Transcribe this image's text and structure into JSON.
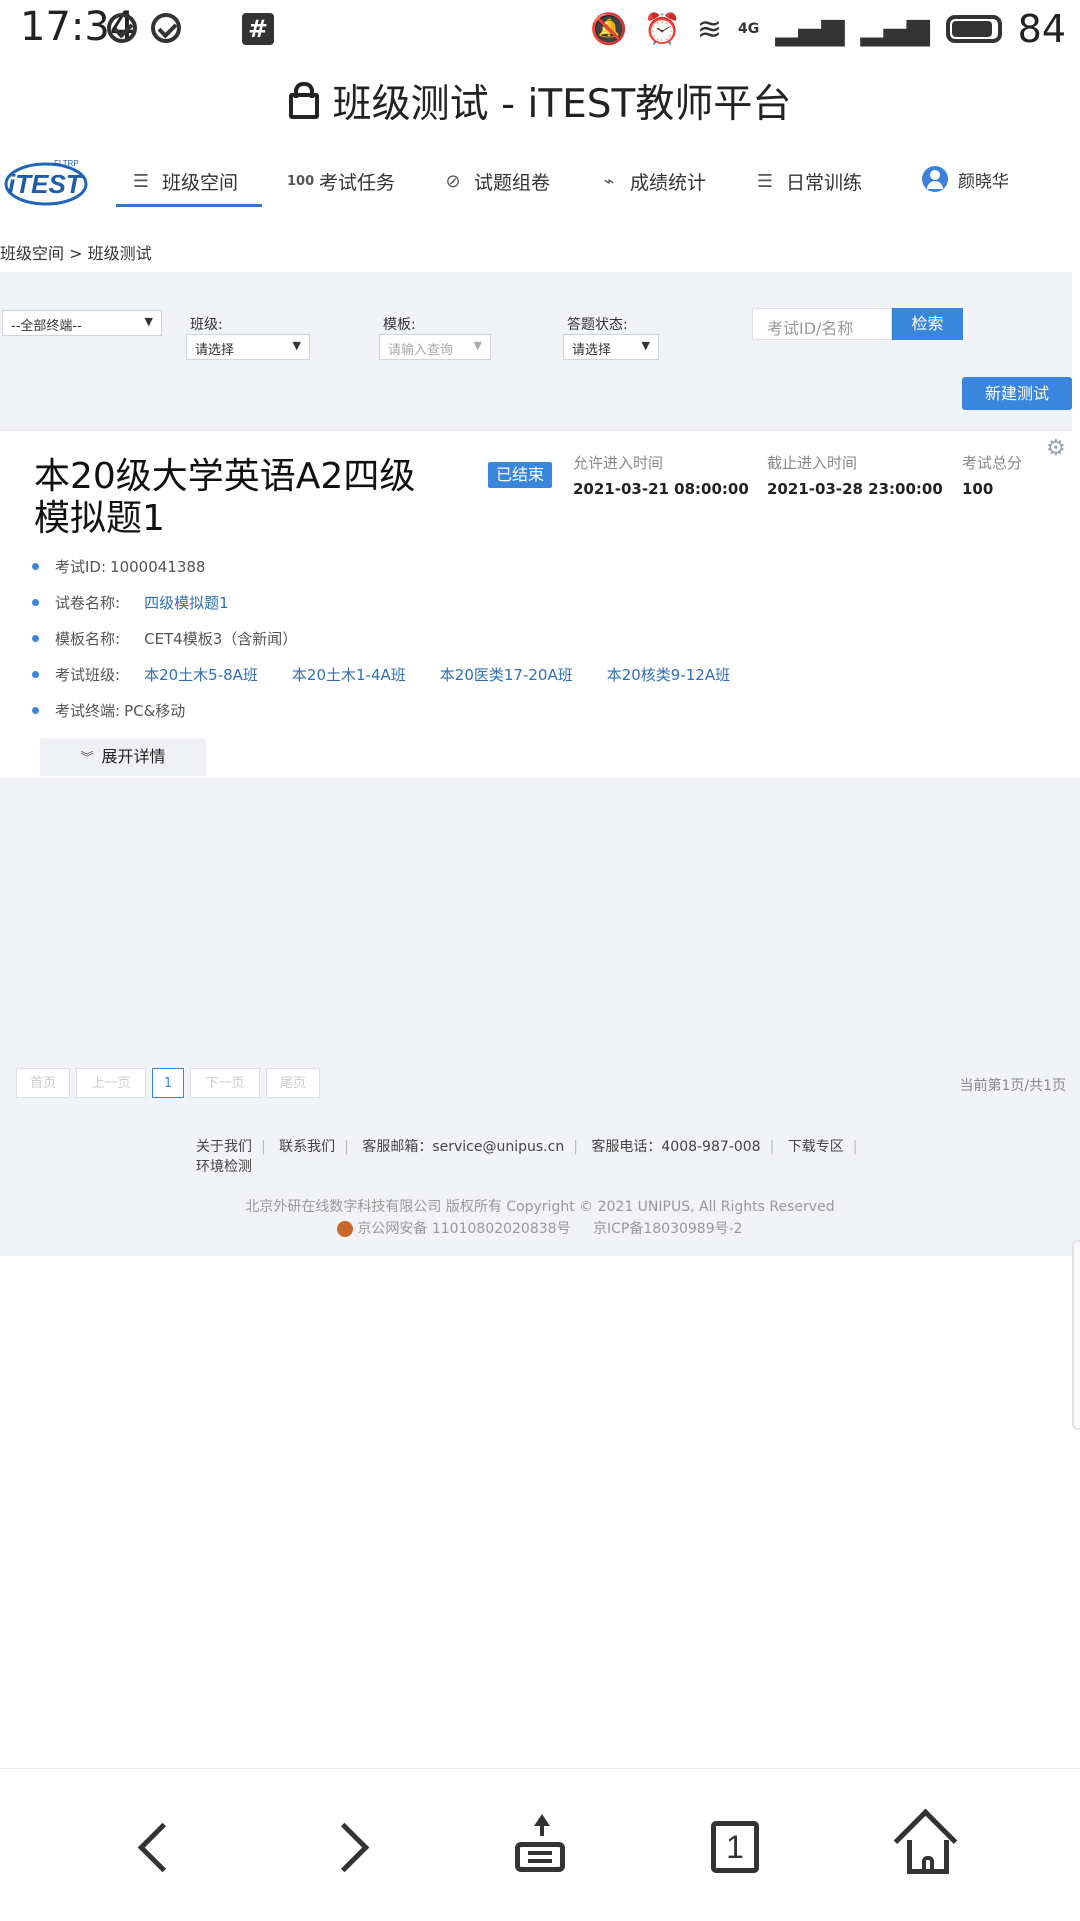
{
  "status_bar": {
    "time": "17:34",
    "network_label": "4G",
    "battery_pct": "84",
    "icons": [
      "check-circle-icon",
      "check-circle-icon",
      "hash-notification-icon",
      "mute-icon",
      "alarm-icon",
      "wifi-icon",
      "signal-icon",
      "signal-icon",
      "battery-icon"
    ]
  },
  "url_bar": {
    "title": "班级测试 - iTEST教师平台"
  },
  "nav": {
    "logo": {
      "text": "iTEST",
      "small": "FLTRP"
    },
    "items": [
      {
        "label": "班级空间",
        "icon": "menu-icon"
      },
      {
        "label": "考试任务",
        "icon": "score-icon"
      },
      {
        "label": "试题组卷",
        "icon": "paper-icon"
      },
      {
        "label": "成绩统计",
        "icon": "trend-icon"
      },
      {
        "label": "日常训练",
        "icon": "menu-icon"
      }
    ],
    "active_index": 0,
    "user": "颜晓华"
  },
  "breadcrumb": "班级空间 > 班级测试",
  "filters": {
    "terminal": "--全部终端--",
    "class_label": "班级:",
    "class_value": "请选择",
    "template_label": "模板:",
    "template_placeholder": "请输入查询",
    "status_label": "答题状态:",
    "status_value": "请选择",
    "search_placeholder": "考试ID/名称",
    "search_button": "检索",
    "new_test_button": "新建测试"
  },
  "exam": {
    "title": "本20级大学英语A2四级模拟题1",
    "status": "已结束",
    "start_label": "允许进入时间",
    "start_time": "2021-03-21 08:00:00",
    "end_label": "截止进入时间",
    "end_time": "2021-03-28 23:00:00",
    "score_label": "考试总分",
    "score": "100",
    "id_label": "考试ID:",
    "id": "1000041388",
    "paper_label": "试卷名称:",
    "paper": "四级模拟题1",
    "template_label": "模板名称:",
    "template": "CET4模板3（含新闻）",
    "classes_label": "考试班级:",
    "classes": [
      "本20土木5-8A班",
      "本20土木1-4A班",
      "本20医类17-20A班",
      "本20核类9-12A班"
    ],
    "terminal_label": "考试终端:",
    "terminal": "PC&移动",
    "expand_button": "展开详情"
  },
  "pagination": {
    "first": "首页",
    "prev": "上一页",
    "current": "1",
    "next": "下一页",
    "last": "尾页",
    "info": "当前第1页/共1页"
  },
  "footer": {
    "links": [
      "关于我们",
      "联系我们",
      "客服邮箱：service@unipus.cn",
      "客服电话：4008-987-008",
      "下载专区"
    ],
    "env_check": "环境检测",
    "copyright": "北京外研在线数字科技有限公司 版权所有 Copyright © 2021 UNIPUS, All Rights Reserved",
    "police": "京公网安备 11010802020838号",
    "icp": "京ICP备18030989号-2"
  },
  "browser_bar": {
    "tab_count": "1",
    "icons": [
      "back-icon",
      "forward-icon",
      "share-icon",
      "tabs-icon",
      "home-icon"
    ]
  }
}
